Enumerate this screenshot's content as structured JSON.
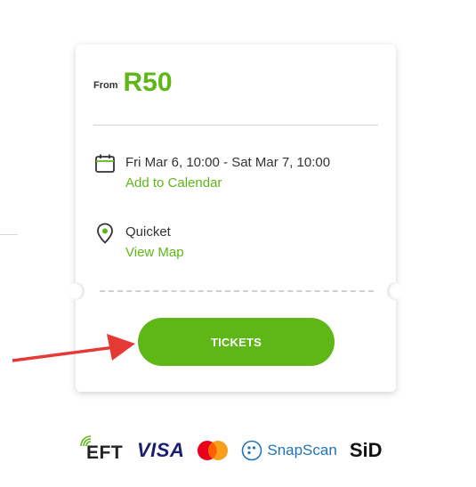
{
  "price": {
    "from_label": "From",
    "value": "R50"
  },
  "event": {
    "date_range": "Fri Mar 6, 10:00 - Sat Mar 7, 10:00",
    "add_to_calendar": "Add to Calendar",
    "venue": "Quicket",
    "view_map": "View Map"
  },
  "tickets_button": {
    "label": "TICKETS"
  },
  "payment_methods": {
    "eft": "EFT",
    "visa": "VISA",
    "mastercard": "mastercard",
    "snapscan": "SnapScan",
    "sid": "SiD"
  },
  "colors": {
    "accent": "#5eb716",
    "arrow": "#e53935",
    "visa": "#1a1f71",
    "snapscan": "#1e74b5"
  },
  "icons": {
    "calendar": "calendar-icon",
    "location": "location-pin-icon",
    "annotation": "red-arrow-icon"
  }
}
